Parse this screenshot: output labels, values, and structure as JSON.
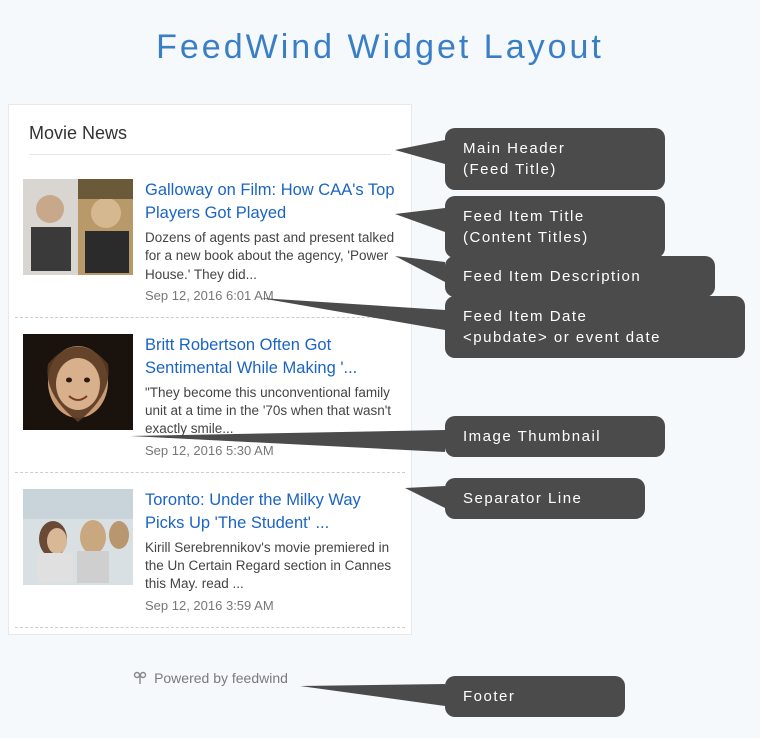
{
  "page": {
    "title": "FeedWind Widget Layout"
  },
  "widget": {
    "header": "Movie News",
    "footer_text": "Powered by feedwind",
    "items": [
      {
        "title": "Galloway on Film: How CAA's Top Players Got Played",
        "desc": "Dozens of agents past and present talked for a new book about the agency, 'Power House.' They did...",
        "date": "Sep 12, 2016 6:01 AM"
      },
      {
        "title": "Britt Robertson Often Got Sentimental While Making '...",
        "desc": "\"They become this unconventional family unit at a time in the '70s when that wasn't exactly smile...",
        "date": "Sep 12, 2016 5:30 AM"
      },
      {
        "title": "Toronto: Under the Milky Way Picks Up 'The Student' ...",
        "desc": "Kirill Serebrennikov's movie premiered in the Un Certain Regard section in Cannes this May. read ...",
        "date": "Sep 12, 2016 3:59 AM"
      }
    ]
  },
  "callouts": {
    "main_header": "Main Header\n(Feed Title)",
    "item_title": "Feed Item Title\n(Content Titles)",
    "item_desc": "Feed Item Description",
    "item_date": "Feed Item Date\n<pubdate>  or event date",
    "thumbnail": "Image Thumbnail",
    "separator": "Separator Line",
    "footer": "Footer"
  }
}
